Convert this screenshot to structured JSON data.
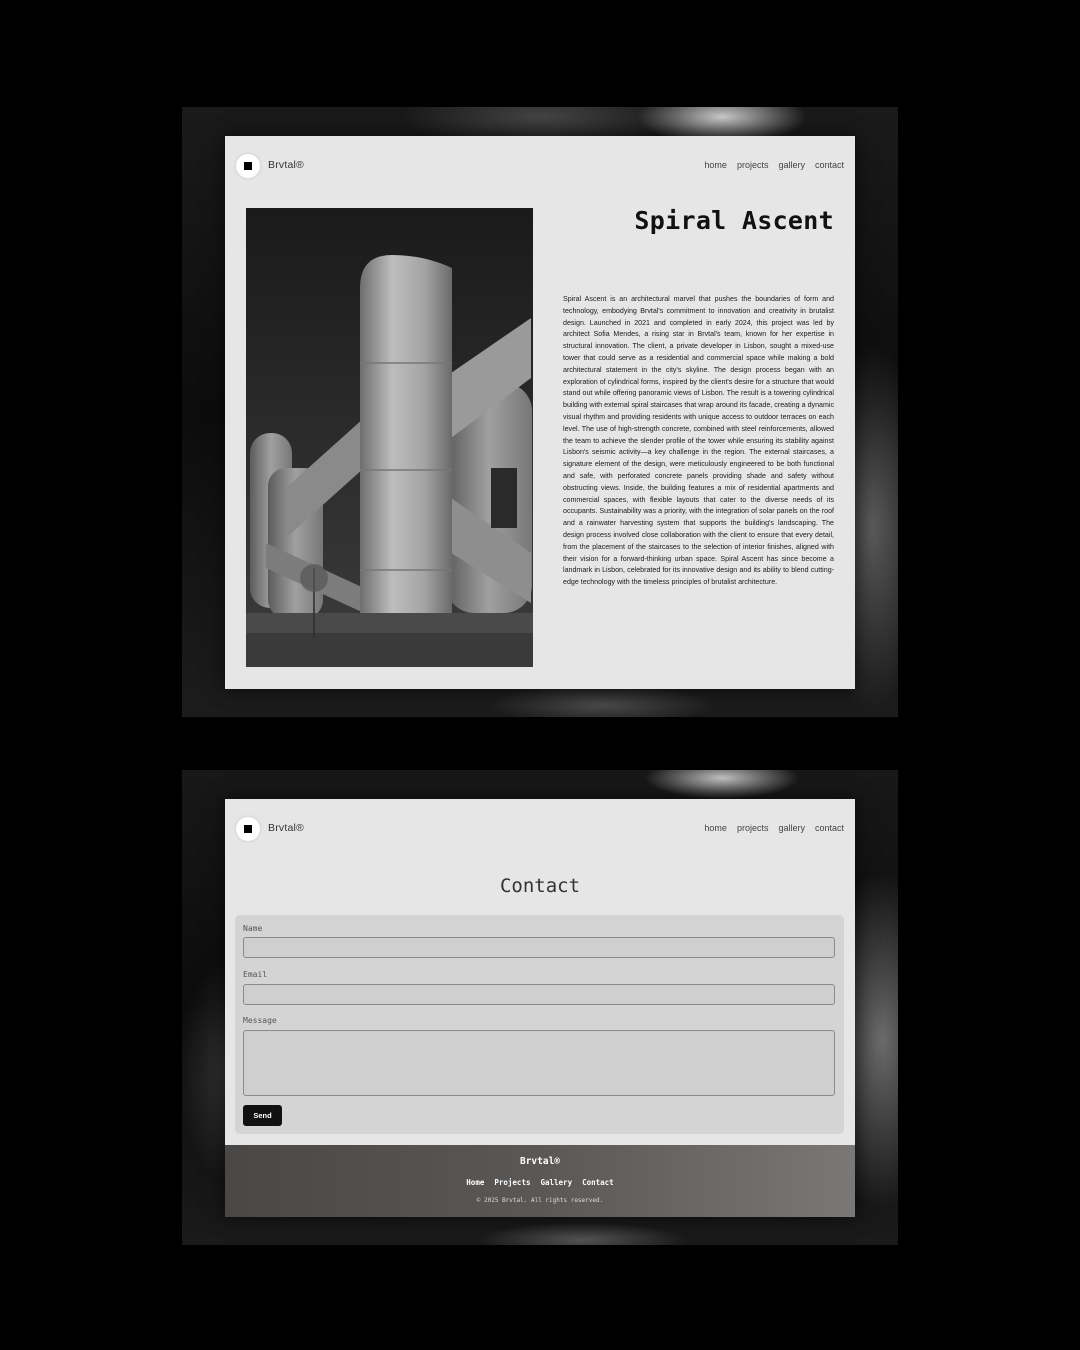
{
  "colors": {
    "page_background": "#000000",
    "screen_background": "#e6e6e6",
    "form_background": "#d4d4d4",
    "button_background": "#111111",
    "footer_background": "#5a5856"
  },
  "icons": {
    "logo": "black-square-in-circle"
  },
  "project_page": {
    "nav": {
      "brand": "Brvtal®",
      "links": [
        "home",
        "projects",
        "gallery",
        "contact"
      ]
    },
    "title": "Spiral Ascent",
    "body": "Spiral Ascent is an architectural marvel that pushes the boundaries of form and technology, embodying Brvtal's commitment to innovation and creativity in brutalist design. Launched in 2021 and completed in early 2024, this project was led by architect Sofia Mendes, a rising star in Brvtal's team, known for her expertise in structural innovation. The client, a private developer in Lisbon, sought a mixed-use tower that could serve as a residential and commercial space while making a bold architectural statement in the city's skyline. The design process began with an exploration of cylindrical forms, inspired by the client's desire for a structure that would stand out while offering panoramic views of Lisbon. The result is a towering cylindrical building with external spiral staircases that wrap around its facade, creating a dynamic visual rhythm and providing residents with unique access to outdoor terraces on each level. The use of high-strength concrete, combined with steel reinforcements, allowed the team to achieve the slender profile of the tower while ensuring its stability against Lisbon's seismic activity—a key challenge in the region. The external staircases, a signature element of the design, were meticulously engineered to be both functional and safe, with perforated concrete panels providing shade and safety without obstructing views. Inside, the building features a mix of residential apartments and commercial spaces, with flexible layouts that cater to the diverse needs of its occupants. Sustainability was a priority, with the integration of solar panels on the roof and a rainwater harvesting system that supports the building's landscaping. The design process involved close collaboration with the client to ensure that every detail, from the placement of the staircases to the selection of interior finishes, aligned with their vision for a forward-thinking urban space. Spiral Ascent has since become a landmark in Lisbon, celebrated for its innovative design and its ability to blend cutting-edge technology with the timeless principles of brutalist architecture."
  },
  "contact_page": {
    "nav": {
      "brand": "Brvtal®",
      "links": [
        "home",
        "projects",
        "gallery",
        "contact"
      ]
    },
    "title": "Contact",
    "form": {
      "name_label": "Name",
      "name_value": "",
      "email_label": "Email",
      "email_value": "",
      "message_label": "Message",
      "message_value": "",
      "send_label": "Send"
    },
    "footer": {
      "brand": "Brvtal®",
      "links": [
        "Home",
        "Projects",
        "Gallery",
        "Contact"
      ],
      "copyright": "© 2025 Brvtal. All rights reserved."
    }
  }
}
